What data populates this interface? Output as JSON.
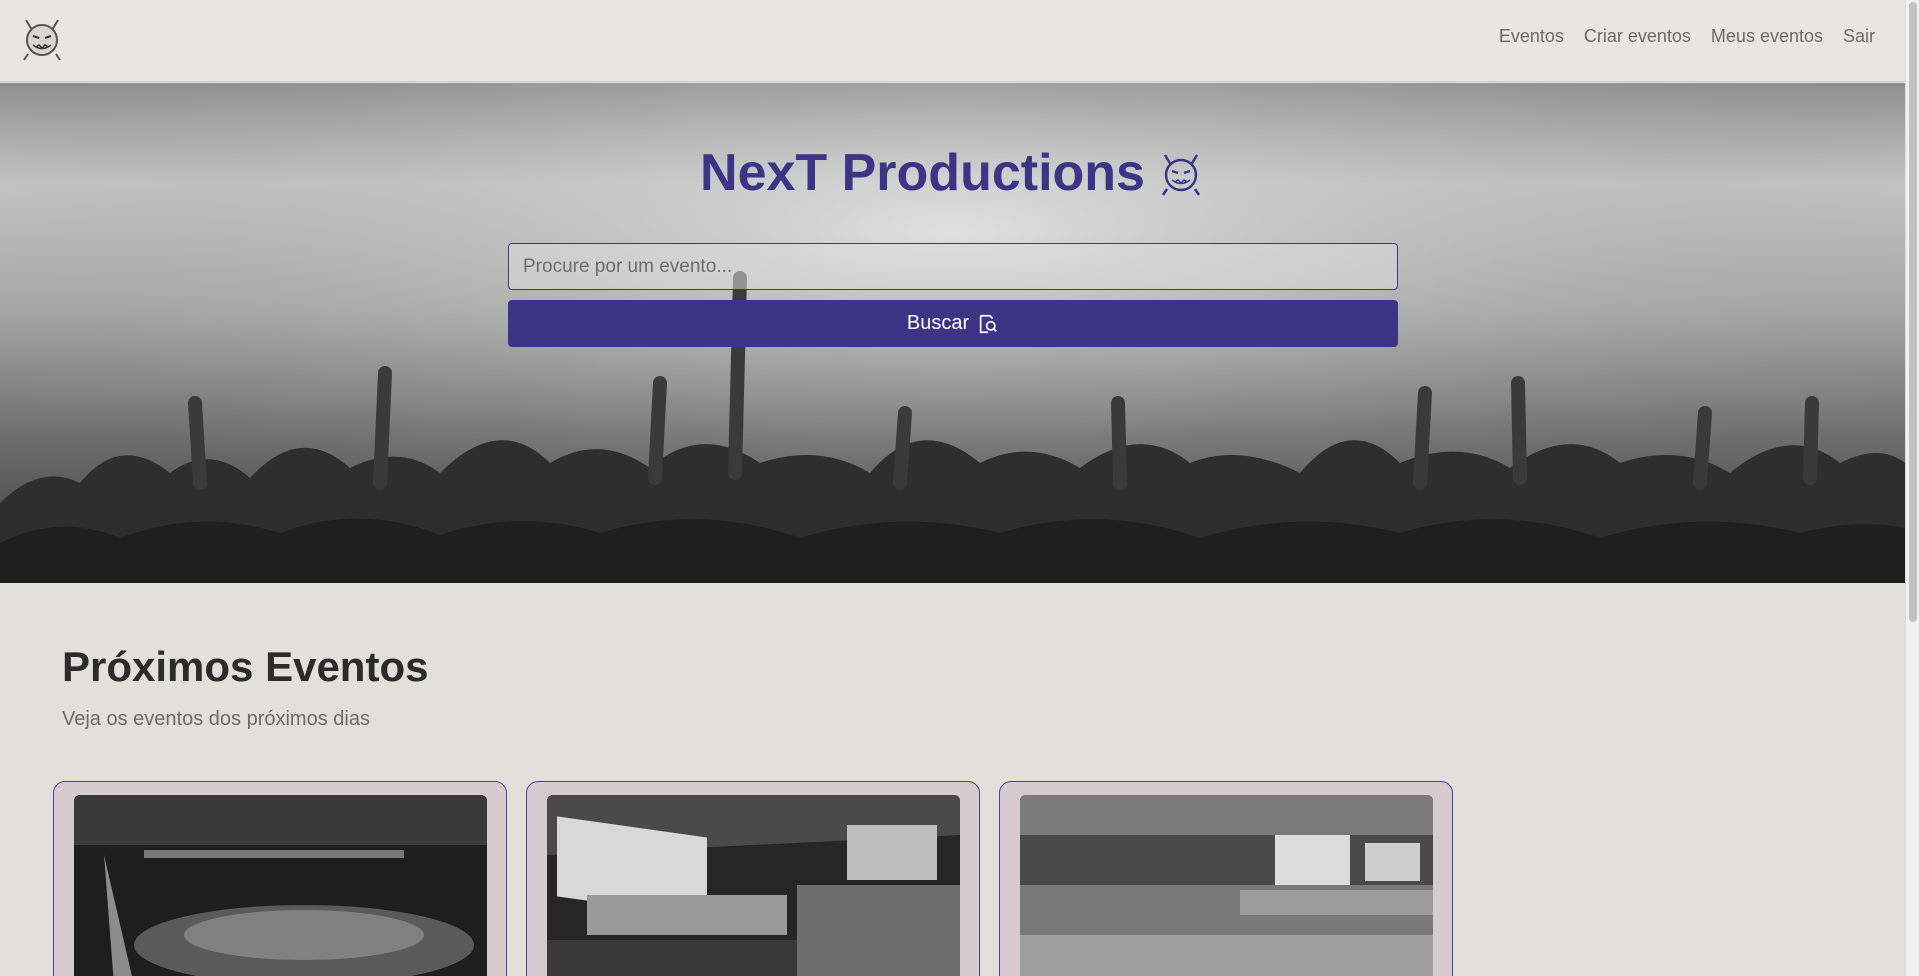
{
  "nav": {
    "logo_icon": "devil-mascot-icon",
    "links": [
      "Eventos",
      "Criar eventos",
      "Meus eventos",
      "Sair"
    ]
  },
  "hero": {
    "title": "NexT Productions",
    "title_icon": "devil-mascot-icon",
    "search": {
      "placeholder": "Procure por um evento...",
      "value": ""
    },
    "button_label": "Buscar",
    "button_icon": "search-document-icon"
  },
  "events": {
    "title": "Próximos Eventos",
    "subtitle": "Veja os eventos dos próximos dias",
    "cards": [
      {
        "image": "event-hall-photo"
      },
      {
        "image": "conference-stage-photo"
      },
      {
        "image": "auditorium-photo"
      }
    ]
  },
  "colors": {
    "accent": "#3d3486",
    "card_bg": "#d6ccd0",
    "page_bg": "#e3e0dc"
  }
}
